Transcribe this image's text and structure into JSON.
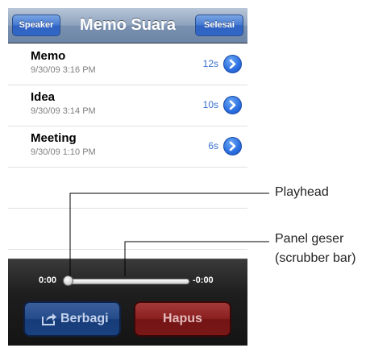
{
  "navbar": {
    "title": "Memo Suara",
    "left_button": "Speaker",
    "right_button": "Selesai"
  },
  "memos": [
    {
      "title": "Memo",
      "date": "9/30/09 3:16 PM",
      "duration": "12s"
    },
    {
      "title": "Idea",
      "date": "9/30/09 3:14 PM",
      "duration": "10s"
    },
    {
      "title": "Meeting",
      "date": "9/30/09 1:10 PM",
      "duration": "6s"
    }
  ],
  "player": {
    "elapsed": "0:00",
    "remaining": "-0:00",
    "progress": 0
  },
  "actions": {
    "share": "Berbagi",
    "delete": "Hapus"
  },
  "callouts": {
    "playhead": "Playhead",
    "scrubber_line1": "Panel geser",
    "scrubber_line2": "(scrubber bar)"
  },
  "colors": {
    "accent": "#3a6fcf",
    "share_button": "#234a8a",
    "delete_button": "#8a1e1e"
  },
  "icons": {
    "disclosure": "chevron-right-icon",
    "share": "share-arrow-icon"
  }
}
